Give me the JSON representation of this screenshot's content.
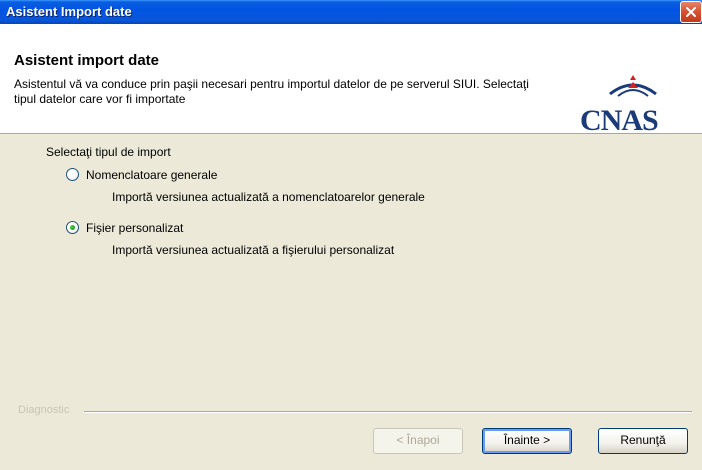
{
  "window": {
    "title": "Asistent Import date"
  },
  "header": {
    "title": "Asistent import date",
    "description": "Asistentul vă va conduce prin paşii necesari pentru importul datelor de pe serverul SIUI. Selectaţi tipul datelor care vor fi importate",
    "logo_text": "CNAS"
  },
  "content": {
    "group_label": "Selectaţi tipul de import",
    "options": [
      {
        "label": "Nomenclatoare generale",
        "description": "Importă versiunea actualizată a nomenclatoarelor generale",
        "selected": false
      },
      {
        "label": "Fişier personalizat",
        "description": "Importă versiunea actualizată a fişierului personalizat",
        "selected": true
      }
    ]
  },
  "footer": {
    "label": "Diagnostic",
    "back_label": "< Înapoi",
    "next_label": "Înainte >",
    "cancel_label": "Renunţă"
  },
  "colors": {
    "titlebar": "#0054e3",
    "dialog_bg": "#ece9d8",
    "logo": "#1a3a7a"
  }
}
